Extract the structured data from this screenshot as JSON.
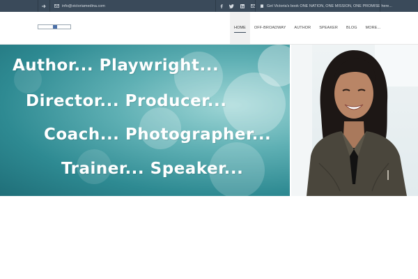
{
  "topbar": {
    "email": "info@victoriamedina.com",
    "promo": "Get Victoria's book ONE NATION, ONE MISSION, ONE PROMISE here...",
    "social": [
      "facebook-icon",
      "twitter-icon",
      "linkedin-icon",
      "mail-icon"
    ],
    "bg": "#3a4a5a"
  },
  "nav": {
    "items": [
      "HOME",
      "OFF-BROADWAY",
      "AUTHOR",
      "SPEAKER",
      "BLOG",
      "MORE..."
    ],
    "active": "HOME"
  },
  "hero": {
    "lines": [
      "Author...  Playwright...",
      "Director...  Producer...",
      "Coach...  Photographer...",
      "Trainer...  Speaker..."
    ]
  }
}
